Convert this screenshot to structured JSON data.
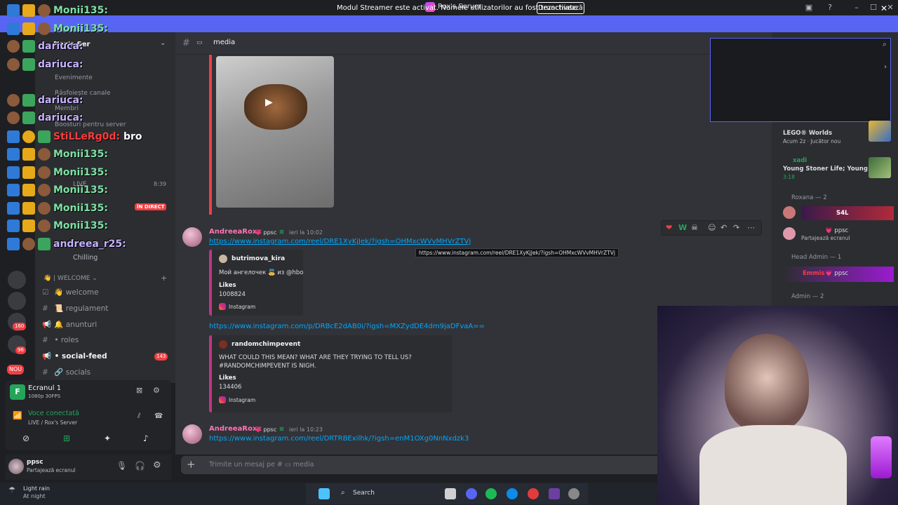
{
  "window": {
    "title": "Rox's Server"
  },
  "streamer_bar": {
    "message": "Modul Streamer este activat. Numele utilizatorilor au fost trunchiate.",
    "button": "Dezactivează"
  },
  "overlay_chat": [
    {
      "user": "Monii135:",
      "style": "green",
      "text": ""
    },
    {
      "user": "Monii135:",
      "style": "green",
      "text": ""
    },
    {
      "user": "dariuca:",
      "style": "purple",
      "text": ""
    },
    {
      "user": "dariuca:",
      "style": "purple",
      "text": ""
    },
    {
      "user": "dariuca:",
      "style": "purple",
      "text": ""
    },
    {
      "user": "dariuca:",
      "style": "purple",
      "text": ""
    },
    {
      "user": "StiLLeRg0d:",
      "style": "red",
      "text": "bro"
    },
    {
      "user": "Monii135:",
      "style": "green",
      "text": ""
    },
    {
      "user": "Monii135:",
      "style": "green",
      "text": ""
    },
    {
      "user": "Monii135:",
      "style": "green",
      "text": ""
    },
    {
      "user": "Monii135:",
      "style": "green",
      "text": ""
    },
    {
      "user": "Monii135:",
      "style": "green",
      "text": ""
    },
    {
      "user": "andreea_r25:",
      "style": "purple",
      "text": ""
    }
  ],
  "sidebar": {
    "server_name": "Rox's Ser",
    "menu": [
      "Evenimente",
      "Răsfoiește canale",
      "Membri",
      "Boosturi pentru server"
    ],
    "live_label": "LIVE",
    "live_time": "8:39",
    "in_direct": "ÎN DIRECT",
    "status_text": "Chilling",
    "category": "| WELCOME",
    "channels": [
      {
        "name": "welcome"
      },
      {
        "name": "regulament"
      },
      {
        "name": "anunturi"
      },
      {
        "name": "roles"
      },
      {
        "name": "social-feed",
        "badge": "143"
      },
      {
        "name": "socials"
      }
    ],
    "server_badges": [
      "143",
      "160",
      "96",
      "NOU"
    ]
  },
  "voice": {
    "screen_title": "Ecranul 1",
    "screen_quality": "1080p 30FPS",
    "connected": "Voce conectată",
    "location": "LIVE / Rox's Server"
  },
  "user_panel": {
    "name": "ppsc",
    "status": "Partajează ecranul"
  },
  "channel_header": {
    "name": "media"
  },
  "messages": [
    {
      "author": "AndreeaRoxx",
      "tag": "ppsc",
      "time": "ieri la 10:02",
      "link": "https://www.instagram.com/reel/DRE1XyKjJek/?igsh=OHMxcWVvMHVrZTVj",
      "tooltip": "https://www.instagram.com/reel/DRE1XyKjJek/?igsh=OHMxcWVvMHVrZTVj",
      "embed": {
        "author": "butrimova_kira",
        "desc": "Мой ангелочек 👼 из @hbo",
        "field_name": "Likes",
        "field_value": "1008824",
        "footer": "Instagram"
      }
    },
    {
      "link": "https://www.instagram.com/p/DRBcE2dAB0i/?igsh=MXZydDE4dm9jaDFvaA==",
      "embed": {
        "author": "randomchimpevent",
        "desc1": "WHAT COULD THIS MEAN? WHAT ARE THEY TRYING TO TELL US?",
        "desc2": "#RANDOMCHIMPEVENT IS NIGH.",
        "field_name": "Likes",
        "field_value": "134406",
        "footer": "Instagram"
      }
    },
    {
      "author": "AndreeaRoxx",
      "tag": "ppsc",
      "time": "ieri la 10:23",
      "link": "https://www.instagram.com/reel/DRTRBExilhk/?igsh=enM1OXg0NnNxdzk3"
    }
  ],
  "composer": {
    "placeholder": "Trimite un mesaj pe #",
    "channel": "media"
  },
  "right_panel": {
    "activity1": {
      "game": "LEGO® Worlds",
      "meta": "Acum 2z",
      "extra": "Jucător nou"
    },
    "activity2": {
      "user": "xadi",
      "game": "Young Stoner Life; Young T...",
      "time": "3:18"
    },
    "groups": [
      {
        "label": "Roxana — 2"
      },
      {
        "label": "Head Admin — 1"
      },
      {
        "label": "Admin — 2"
      }
    ],
    "members": [
      {
        "name": "S4L",
        "status": ""
      },
      {
        "name": "ppsc",
        "status": "Partajează ecranul"
      },
      {
        "name": "Emmis",
        "tag": "ppsc"
      }
    ]
  },
  "weather": {
    "line1": "Light rain",
    "line2": "At night"
  },
  "taskbar": {
    "search": "Search"
  }
}
